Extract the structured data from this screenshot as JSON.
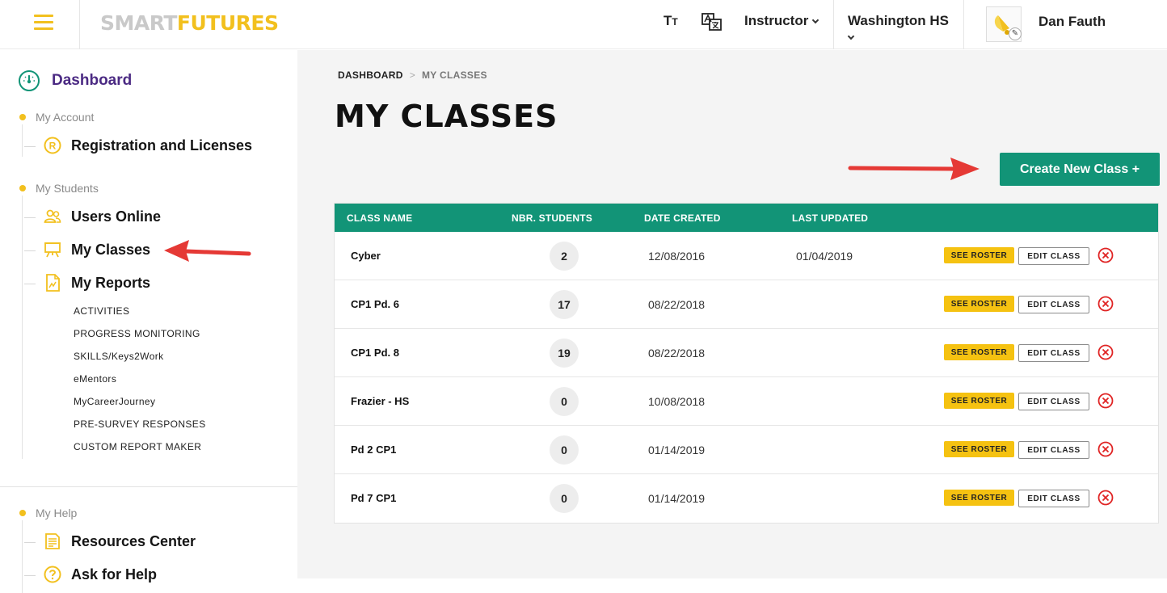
{
  "header": {
    "logo_smart": "SMART",
    "logo_futures": "FUTURES",
    "text_size_icon_main": "T",
    "text_size_icon_small": "T",
    "role": "Instructor",
    "school": "Washington HS",
    "user_name": "Dan Fauth"
  },
  "sidebar": {
    "dashboard": "Dashboard",
    "sections": {
      "account": "My Account",
      "students": "My Students",
      "help": "My Help"
    },
    "items": {
      "registration": "Registration and Licenses",
      "users_online": "Users Online",
      "my_classes": "My Classes",
      "my_reports": "My Reports",
      "resources": "Resources Center",
      "ask_help": "Ask for Help"
    },
    "report_links": [
      "ACTIVITIES",
      "PROGRESS MONITORING",
      "SKILLS/Keys2Work",
      "eMentors",
      "MyCareerJourney",
      "PRE-SURVEY RESPONSES",
      "CUSTOM REPORT MAKER"
    ]
  },
  "main": {
    "breadcrumb": {
      "home": "DASHBOARD",
      "separator": ">",
      "current": "MY CLASSES"
    },
    "title": "MY CLASSES",
    "create_button": "Create New Class +",
    "table": {
      "headers": [
        "CLASS NAME",
        "NBR. STUDENTS",
        "DATE CREATED",
        "LAST UPDATED"
      ],
      "roster_label": "SEE ROSTER",
      "edit_label": "EDIT CLASS",
      "rows": [
        {
          "name": "Cyber",
          "students": "2",
          "created": "12/08/2016",
          "updated": "01/04/2019"
        },
        {
          "name": "CP1 Pd. 6",
          "students": "17",
          "created": "08/22/2018",
          "updated": ""
        },
        {
          "name": "CP1 Pd. 8",
          "students": "19",
          "created": "08/22/2018",
          "updated": ""
        },
        {
          "name": "Frazier - HS",
          "students": "0",
          "created": "10/08/2018",
          "updated": ""
        },
        {
          "name": "Pd 2 CP1",
          "students": "0",
          "created": "01/14/2019",
          "updated": ""
        },
        {
          "name": "Pd 7 CP1",
          "students": "0",
          "created": "01/14/2019",
          "updated": ""
        }
      ]
    }
  },
  "colors": {
    "accent_green": "#129477",
    "accent_yellow": "#f2c01e",
    "dashboard_purple": "#4b2a83",
    "annotation_red": "#e53935",
    "delete_red": "#e02424"
  }
}
